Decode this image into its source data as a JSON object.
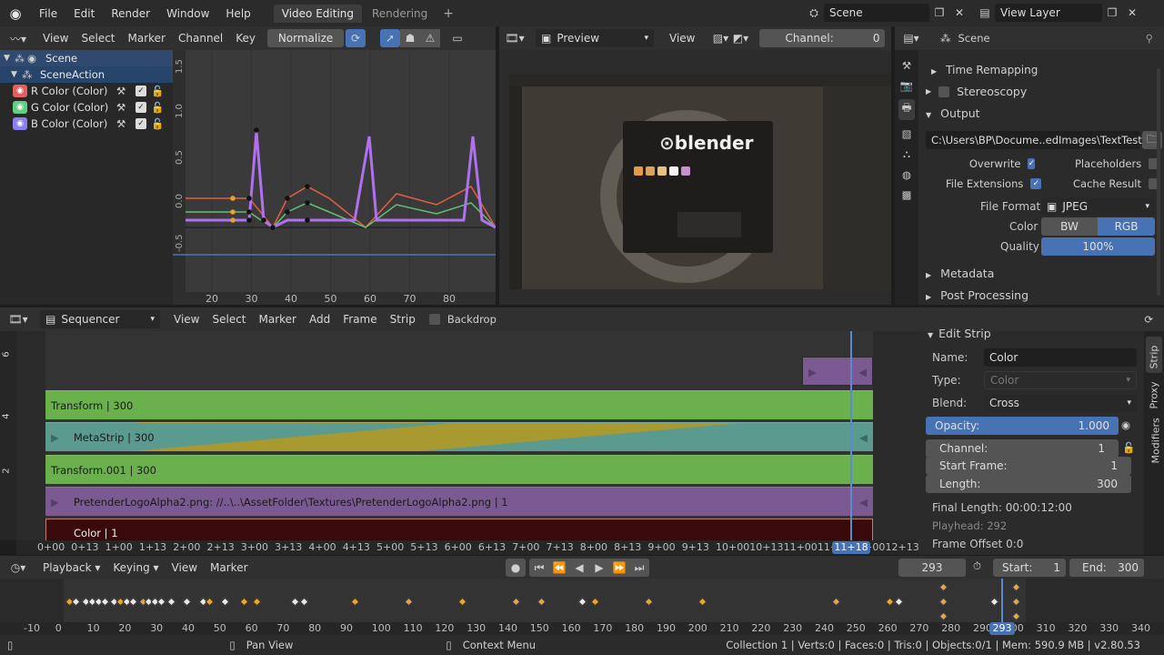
{
  "topbar": {
    "menus": [
      "File",
      "Edit",
      "Render",
      "Window",
      "Help"
    ],
    "tabs": [
      {
        "label": "Video Editing",
        "active": true
      },
      {
        "label": "Rendering",
        "active": false
      }
    ],
    "scene": "Scene",
    "view_layer": "View Layer"
  },
  "graph_editor": {
    "menus": [
      "View",
      "Select",
      "Marker",
      "Channel",
      "Key"
    ],
    "normalize_label": "Normalize",
    "tree": {
      "scene": "Scene",
      "action": "SceneAction",
      "channels": [
        {
          "label": "R Color (Color)",
          "color": "#e06060"
        },
        {
          "label": "G Color (Color)",
          "color": "#60d080"
        },
        {
          "label": "B Color (Color)",
          "color": "#8a80f0"
        }
      ]
    },
    "y_ticks": [
      "1.5",
      "1.0",
      "0.5",
      "0.0",
      "-0.5"
    ],
    "x_ticks": [
      "20",
      "30",
      "40",
      "50",
      "60",
      "70",
      "80"
    ]
  },
  "preview": {
    "mode": "Preview",
    "view_menu": "View",
    "channel_label": "Channel:",
    "channel_value": "0",
    "logo_text": "blender"
  },
  "properties": {
    "scene": "Scene",
    "time_remapping": "Time Remapping",
    "stereoscopy": "Stereoscopy",
    "output": "Output",
    "path": "C:\\Users\\BP\\Docume..edImages\\TextTestVSE",
    "overwrite": "Overwrite",
    "placeholders": "Placeholders",
    "file_extensions": "File Extensions",
    "cache_result": "Cache Result",
    "file_format_label": "File Format",
    "file_format": "JPEG",
    "color_label": "Color",
    "color_bw": "BW",
    "color_rgb": "RGB",
    "quality_label": "Quality",
    "quality": "100%",
    "quality_fraction": 1.0,
    "metadata": "Metadata",
    "post_processing": "Post Processing"
  },
  "sequencer": {
    "mode": "Sequencer",
    "menus": [
      "View",
      "Select",
      "Marker",
      "Add",
      "Frame",
      "Strip"
    ],
    "backdrop": "Backdrop",
    "channel_numbers": [
      "6",
      "4",
      "2"
    ],
    "strips": [
      {
        "label": "Transform | 300",
        "color": "#6ab04c"
      },
      {
        "label": "MetaStrip | 300",
        "color": "#5b9a8e"
      },
      {
        "label": "Transform.001 | 300",
        "color": "#6ab04c"
      },
      {
        "label": "PretenderLogoAlpha2.png: //..\\..\\AssetFolder\\Textures\\PretenderLogoAlpha2.png | 1",
        "color": "#7a5a90"
      },
      {
        "label": "Color | 1",
        "color": "#3a0a0a"
      }
    ],
    "time_ticks": [
      "0+00",
      "0+13",
      "1+00",
      "1+13",
      "2+00",
      "2+13",
      "3+00",
      "3+13",
      "4+00",
      "4+13",
      "5+00",
      "5+13",
      "6+00",
      "6+13",
      "7+00",
      "7+13",
      "8+00",
      "8+13",
      "9+00",
      "9+13",
      "10+00",
      "10+13",
      "11+00",
      "11+13",
      "12+00",
      "12+13"
    ],
    "playhead": "11+18"
  },
  "strip_panel": {
    "title": "Edit Strip",
    "name_label": "Name:",
    "name": "Color",
    "type_label": "Type:",
    "type": "Color",
    "blend_label": "Blend:",
    "blend": "Cross",
    "opacity_label": "Opacity:",
    "opacity": "1.000",
    "channel_label": "Channel:",
    "channel": "1",
    "start_label": "Start Frame:",
    "start": "1",
    "length_label": "Length:",
    "length": "300",
    "final_length": "Final Length: 00:00:12:00",
    "playhead": "Playhead: 292",
    "frame_offset": "Frame Offset 0:0",
    "tabs": [
      "Strip",
      "Proxy",
      "Modifiers"
    ]
  },
  "timeline": {
    "menus": [
      "Playback",
      "Keying",
      "View",
      "Marker"
    ],
    "current_frame": "293",
    "start_label": "Start:",
    "start": "1",
    "end_label": "End:",
    "end": "300",
    "ticks": [
      "-10",
      "0",
      "10",
      "20",
      "30",
      "40",
      "50",
      "60",
      "70",
      "80",
      "90",
      "100",
      "110",
      "120",
      "130",
      "140",
      "150",
      "160",
      "170",
      "180",
      "190",
      "200",
      "210",
      "220",
      "230",
      "240",
      "250",
      "260",
      "270",
      "280",
      "290",
      "300",
      "310",
      "320",
      "330",
      "340"
    ],
    "playhead": "293"
  },
  "statusbar": {
    "pan_view": "Pan View",
    "context_menu": "Context Menu",
    "stats": "Collection 1 | Verts:0 | Faces:0 | Tris:0 | Objects:0/1 | Mem: 590.9 MB | v2.80.53"
  },
  "icons": [
    "blender-logo-icon",
    "graph-editor-icon",
    "sequencer-icon",
    "camera-icon",
    "eye-icon",
    "wrench-icon",
    "lock-icon",
    "folder-icon",
    "play-icon",
    "record-icon"
  ]
}
